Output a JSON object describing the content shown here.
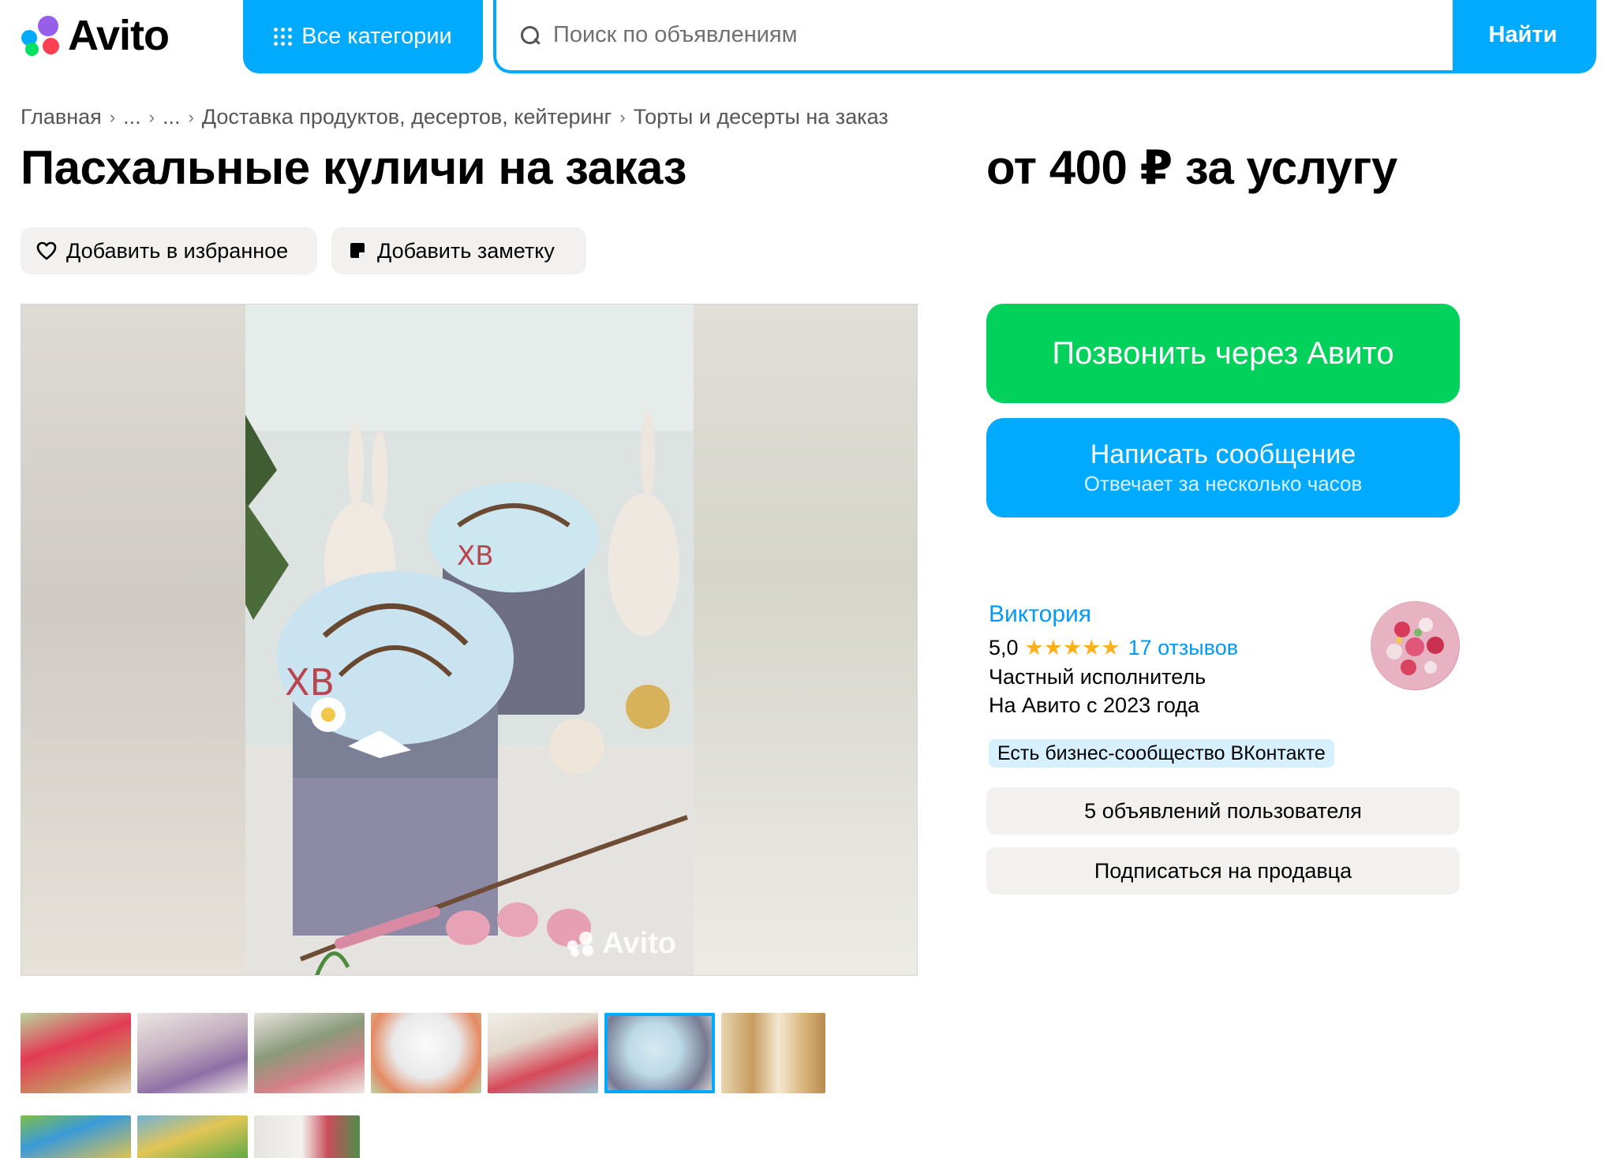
{
  "header": {
    "logo_text": "Avito",
    "categories_label": "Все категории",
    "search_placeholder": "Поиск по объявлениям",
    "find_label": "Найти"
  },
  "breadcrumbs": [
    "Главная",
    "...",
    "...",
    "Доставка продуктов, десертов, кейтеринг",
    "Торты и десерты на заказ"
  ],
  "listing": {
    "title": "Пасхальные куличи на заказ",
    "price": "от 400 ₽ за услугу",
    "favorite_label": "Добавить в избранное",
    "note_label": "Добавить заметку",
    "watermark": "Avito"
  },
  "actions": {
    "call_label": "Позвонить через Авито",
    "message_label": "Написать сообщение",
    "message_sub": "Отвечает за несколько часов"
  },
  "seller": {
    "name": "Виктория",
    "rating": "5,0",
    "stars": "★★★★★",
    "rating_value": 5,
    "reviews": "17 отзывов",
    "type": "Частный исполнитель",
    "since": "На Авито с 2023 года",
    "vk_badge": "Есть бизнес-сообщество ВКонтакте",
    "ads_button": "5 объявлений пользователя",
    "subscribe_button": "Подписаться на продавца"
  },
  "gallery": {
    "thumbnail_count": 10,
    "active_thumbnail": 6
  },
  "colors": {
    "accent_blue": "#00aaff",
    "call_green": "#02d15c",
    "link_blue": "#0099f7",
    "star": "#ffb021",
    "pill_bg": "#f2f1f0"
  }
}
